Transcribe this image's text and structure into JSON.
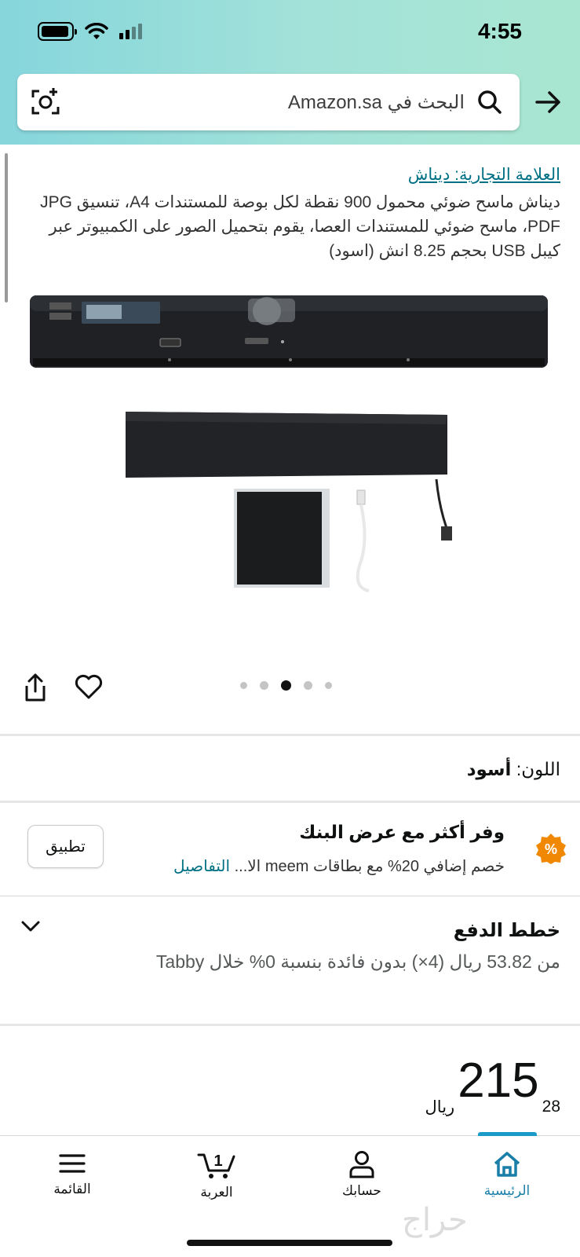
{
  "status_bar": {
    "time": "4:55"
  },
  "search": {
    "placeholder": "البحث في Amazon.sa"
  },
  "product": {
    "brand": "العلامة التجارية: ديناش",
    "title": "ديناش ماسح ضوئي محمول 900 نقطة لكل بوصة للمستندات A4، تنسيق JPG PDF، ماسح ضوئي للمستندات العصا، يقوم بتحميل الصور على الكمبيوتر عبر كيبل USB بحجم 8.25 انش (اسود)",
    "image_dots": 5,
    "active_dot": 2
  },
  "color": {
    "label": "اللون:",
    "value": "أسود"
  },
  "bank_offer": {
    "title": "وفر أكثر مع عرض البنك",
    "desc": "خصم إضافي 20% مع بطاقات meem الا...",
    "details_link": "التفاصيل",
    "apply_label": "تطبيق",
    "badge": "%",
    "badge_color": "#f08804"
  },
  "payment_plans": {
    "title": "خطط الدفع",
    "desc": "من 53.82 ريال (4×) بدون فائدة بنسبة 0% خلال Tabby"
  },
  "price": {
    "currency": "ريال",
    "whole": "215",
    "fraction": "28"
  },
  "nav": {
    "home": "الرئيسية",
    "account": "حسابك",
    "cart": "العربة",
    "cart_count": "1",
    "menu": "القائمة"
  },
  "colors": {
    "accent": "#007185",
    "nav_active": "#1a9ac8"
  },
  "watermark": "حراج"
}
